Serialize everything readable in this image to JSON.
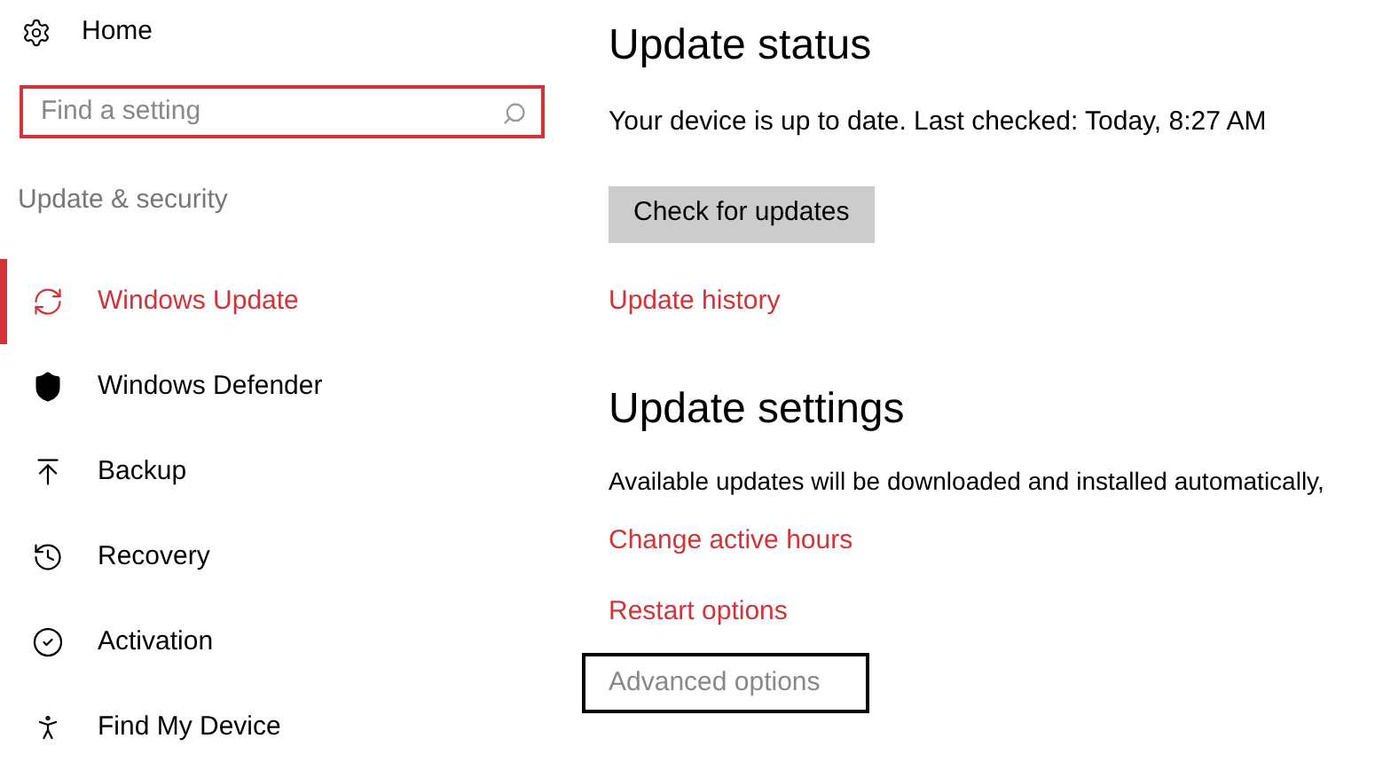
{
  "sidebar": {
    "home": "Home",
    "search": {
      "placeholder": "Find a setting",
      "focused": true
    },
    "section": "Update & security",
    "items": [
      {
        "label": "Windows Update",
        "selected": true
      },
      {
        "label": "Windows Defender",
        "selected": false
      },
      {
        "label": "Backup",
        "selected": false
      },
      {
        "label": "Recovery",
        "selected": false
      },
      {
        "label": "Activation",
        "selected": false
      },
      {
        "label": "Find My Device",
        "selected": false
      }
    ]
  },
  "main": {
    "status_title": "Update status",
    "status_text": "Your device is up to date. Last checked: Today, 8:27 AM",
    "check_button": "Check for updates",
    "history_link": "Update history",
    "settings_title": "Update settings",
    "settings_text": "Available updates will be downloaded and installed automatically,",
    "links": [
      {
        "label": "Change active hours",
        "disabled": false,
        "focused": false
      },
      {
        "label": "Restart options",
        "disabled": false,
        "focused": false
      },
      {
        "label": "Advanced options",
        "disabled": true,
        "focused": true
      }
    ]
  }
}
